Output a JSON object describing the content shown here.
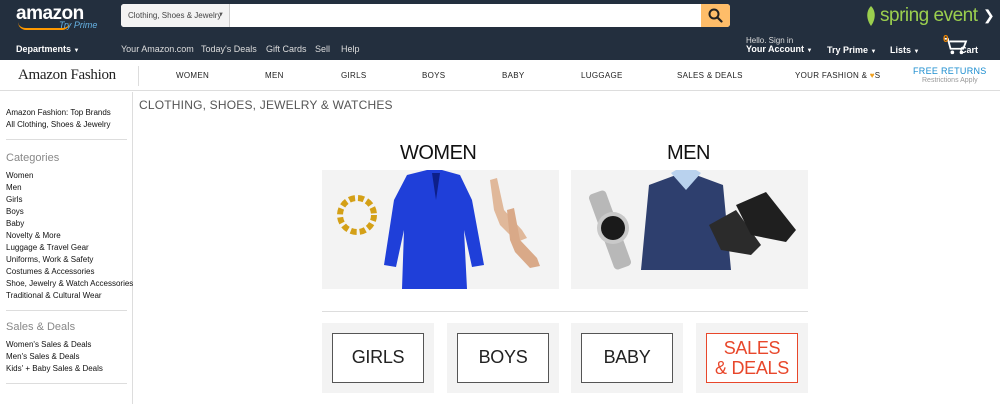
{
  "header": {
    "logo_text": "amazon",
    "logo_prime": "Try Prime",
    "search": {
      "category": "Clothing, Shoes & Jewelry",
      "placeholder": "",
      "value": ""
    },
    "promo_text": "spring event",
    "nav": {
      "departments": "Departments",
      "links": [
        "Your Amazon.com",
        "Today's Deals",
        "Gift Cards",
        "Sell",
        "Help"
      ],
      "account_greeting": "Hello. Sign in",
      "account_label": "Your Account",
      "try_prime": "Try Prime",
      "lists": "Lists",
      "cart_count": "0",
      "cart_label": "Cart"
    }
  },
  "fashion_nav": {
    "logo": "Amazon Fashion",
    "items": [
      "WOMEN",
      "MEN",
      "GIRLS",
      "BOYS",
      "BABY",
      "LUGGAGE",
      "SALES & DEALS",
      "YOUR FASHION & ",
      "S"
    ],
    "free_returns": "FREE RETURNS",
    "restrictions": "Restrictions Apply"
  },
  "sidebar": {
    "top_links": [
      "Amazon Fashion: Top Brands",
      "All Clothing, Shoes & Jewelry"
    ],
    "categories_heading": "Categories",
    "categories": [
      "Women",
      "Men",
      "Girls",
      "Boys",
      "Baby",
      "Novelty & More",
      "Luggage & Travel Gear",
      "Uniforms, Work & Safety",
      "Costumes & Accessories",
      "Shoe, Jewelry & Watch Accessories",
      "Traditional & Cultural Wear"
    ],
    "deals_heading": "Sales & Deals",
    "deals": [
      "Women's Sales & Deals",
      "Men's Sales & Deals",
      "Kids' + Baby Sales & Deals"
    ]
  },
  "main": {
    "title": "CLOTHING, SHOES, JEWELRY & WATCHES",
    "women_title": "WOMEN",
    "men_title": "MEN",
    "sub_tiles": [
      "GIRLS",
      "BOYS",
      "BABY",
      "SALES",
      "& DEALS"
    ]
  },
  "colors": {
    "header_bg": "#232f3e",
    "accent_orange": "#febd69",
    "prime_blue": "#67b4e6",
    "promo_green": "#9bcf4e",
    "free_returns_blue": "#1a8ccf",
    "sales_red": "#e8472b"
  }
}
